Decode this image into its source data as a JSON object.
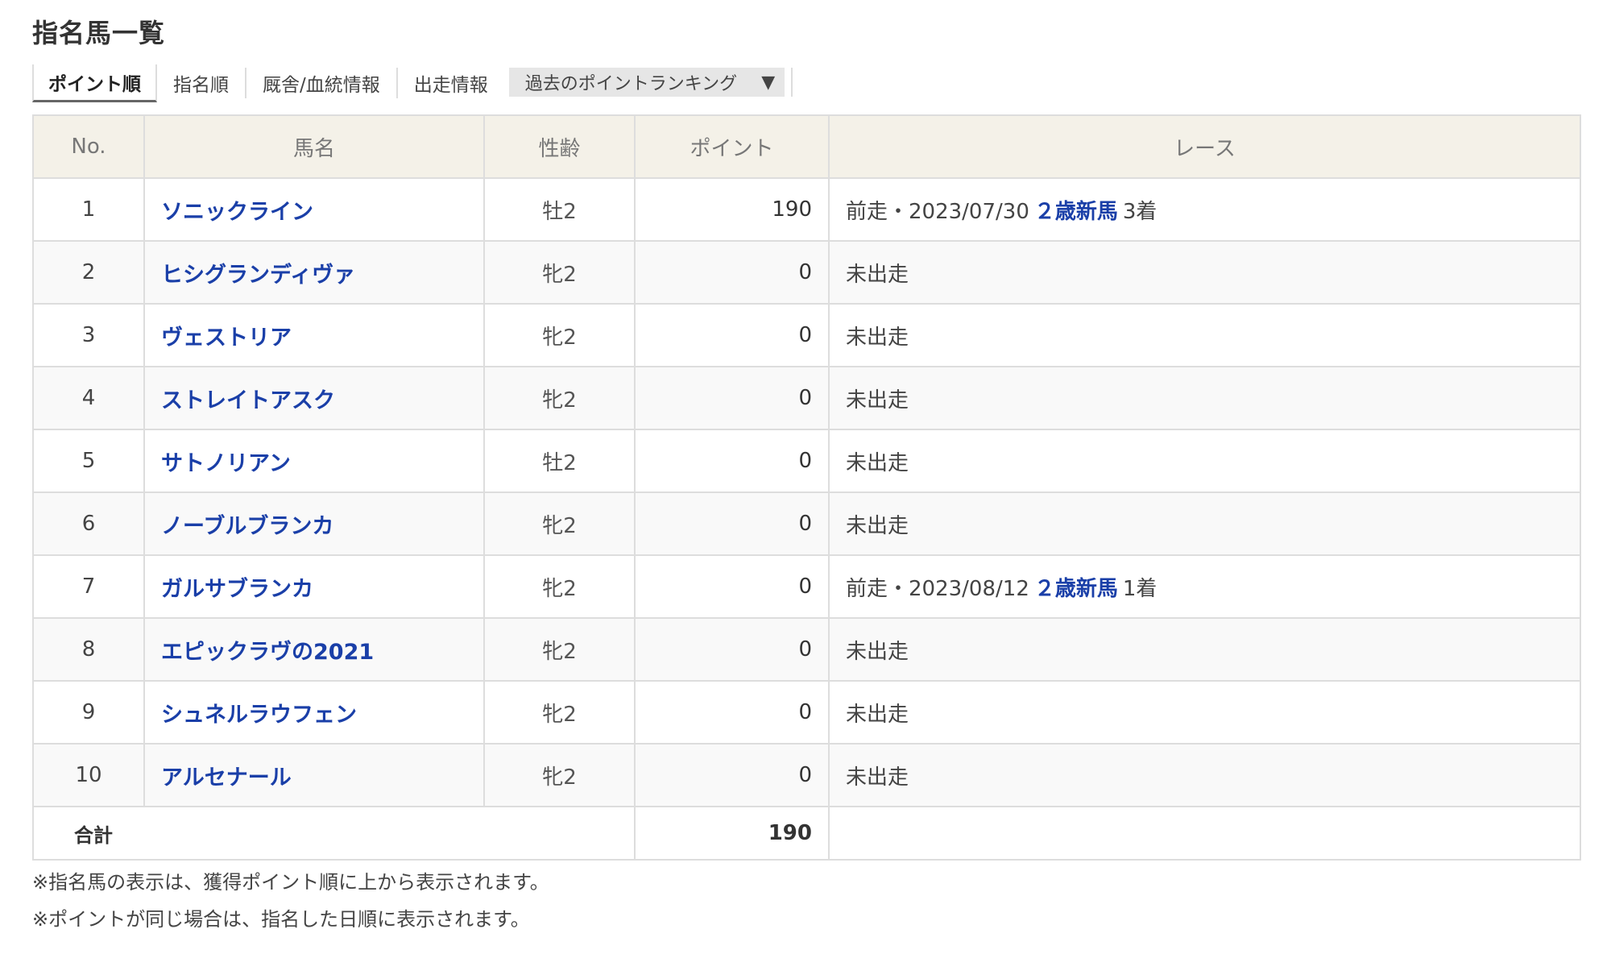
{
  "page": {
    "title": "指名馬一覧"
  },
  "tabs": {
    "items": [
      "ポイント順",
      "指名順",
      "厩舎/血統情報",
      "出走情報"
    ],
    "active_index": 0,
    "select": {
      "value": "過去のポイントランキング",
      "arrow": "▼"
    }
  },
  "table": {
    "headers": [
      "No.",
      "馬名",
      "性齢",
      "ポイント",
      "レース"
    ],
    "rows": [
      {
        "no": "1",
        "name": "ソニックライン",
        "sex_age": "牡2",
        "points": "190",
        "race": {
          "prefix": "前走・2023/07/30",
          "race_name": "２歳新馬",
          "result": "3着"
        }
      },
      {
        "no": "2",
        "name": "ヒシグランディヴァ",
        "sex_age": "牝2",
        "points": "0",
        "race": {
          "text": "未出走"
        }
      },
      {
        "no": "3",
        "name": "ヴェストリア",
        "sex_age": "牝2",
        "points": "0",
        "race": {
          "text": "未出走"
        }
      },
      {
        "no": "4",
        "name": "ストレイトアスク",
        "sex_age": "牝2",
        "points": "0",
        "race": {
          "text": "未出走"
        }
      },
      {
        "no": "5",
        "name": "サトノリアン",
        "sex_age": "牡2",
        "points": "0",
        "race": {
          "text": "未出走"
        }
      },
      {
        "no": "6",
        "name": "ノーブルブランカ",
        "sex_age": "牝2",
        "points": "0",
        "race": {
          "text": "未出走"
        }
      },
      {
        "no": "7",
        "name": "ガルサブランカ",
        "sex_age": "牝2",
        "points": "0",
        "race": {
          "prefix": "前走・2023/08/12",
          "race_name": "２歳新馬",
          "result": "1着"
        }
      },
      {
        "no": "8",
        "name": "エピックラヴの2021",
        "sex_age": "牝2",
        "points": "0",
        "race": {
          "text": "未出走"
        }
      },
      {
        "no": "9",
        "name": "シュネルラウフェン",
        "sex_age": "牝2",
        "points": "0",
        "race": {
          "text": "未出走"
        }
      },
      {
        "no": "10",
        "name": "アルセナール",
        "sex_age": "牝2",
        "points": "0",
        "race": {
          "text": "未出走"
        }
      }
    ],
    "total": {
      "label": "合計",
      "value": "190"
    }
  },
  "notes": [
    "※指名馬の表示は、獲得ポイント順に上から表示されます。",
    "※ポイントが同じ場合は、指名した日順に表示されます。"
  ],
  "colors": {
    "link": "#1a3fa8",
    "header_bg": "#f4f1e8",
    "border": "#dddddd",
    "tab_select_bg": "#e6e6e6"
  }
}
